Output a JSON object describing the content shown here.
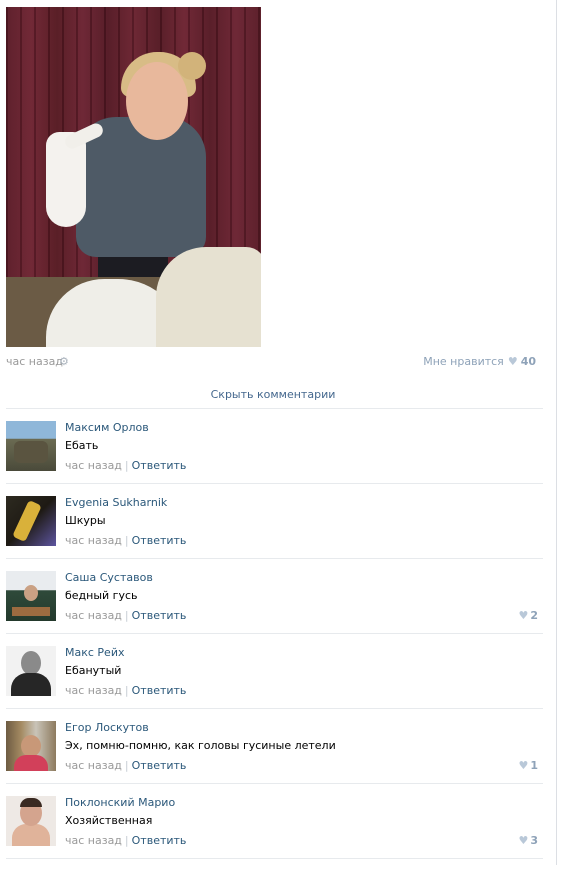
{
  "post": {
    "time": "час назад",
    "like_label": "Мне нравится",
    "like_count": "40",
    "hide_comments": "Скрыть комментарии"
  },
  "comments": [
    {
      "name": "Максим Орлов",
      "text": "Ебать",
      "time": "час назад",
      "reply": "Ответить",
      "likes": ""
    },
    {
      "name": "Evgenia Sukharnik",
      "text": "Шкуры",
      "time": "час назад",
      "reply": "Ответить",
      "likes": ""
    },
    {
      "name": "Саша Суставов",
      "text": "бедный гусь",
      "time": "час назад",
      "reply": "Ответить",
      "likes": "2"
    },
    {
      "name": "Макс Рейх",
      "text": "Ебанутый",
      "time": "час назад",
      "reply": "Ответить",
      "likes": ""
    },
    {
      "name": "Егор Лоскутов",
      "text": "Эх, помню-помню, как головы гусиные летели",
      "time": "час назад",
      "reply": "Ответить",
      "likes": "1"
    },
    {
      "name": "Поклонский Марио",
      "text": "Хозяйственная",
      "time": "час назад",
      "reply": "Ответить",
      "likes": "3"
    }
  ],
  "icons": {
    "gear": "gear-icon",
    "heart": "heart-icon"
  },
  "colors": {
    "link": "#2b587a",
    "muted": "#999999",
    "like": "#8ea2b8"
  }
}
